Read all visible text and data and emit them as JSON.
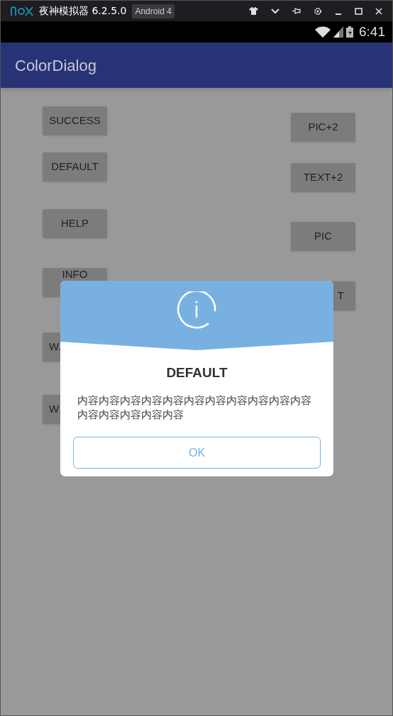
{
  "emulator": {
    "name": "夜神模拟器 6.2.5.0",
    "badge": "Android 4"
  },
  "status_bar": {
    "time": "6:41"
  },
  "app_bar": {
    "title": "ColorDialog"
  },
  "buttons_left": [
    {
      "label": "SUCCESS",
      "kind": "whole"
    },
    {
      "label": "DEFAULT",
      "kind": "whole"
    },
    {
      "label": "HELP",
      "kind": "whole"
    },
    {
      "label": "INFO",
      "kind": "covered_below"
    },
    {
      "label": "W.",
      "kind": "covered_right"
    },
    {
      "label": "W",
      "kind": "covered_right"
    }
  ],
  "buttons_right": [
    {
      "label": "PIC+2",
      "kind": "whole"
    },
    {
      "label": "TEXT+2",
      "kind": "whole"
    },
    {
      "label": "PIC",
      "kind": "whole"
    },
    {
      "label": "T",
      "kind": "covered_left"
    }
  ],
  "dialog": {
    "title": "DEFAULT",
    "message": "内容内容内容内容内容内容内容内容内容内容内容内容内容内容内容内容",
    "button": "OK"
  }
}
